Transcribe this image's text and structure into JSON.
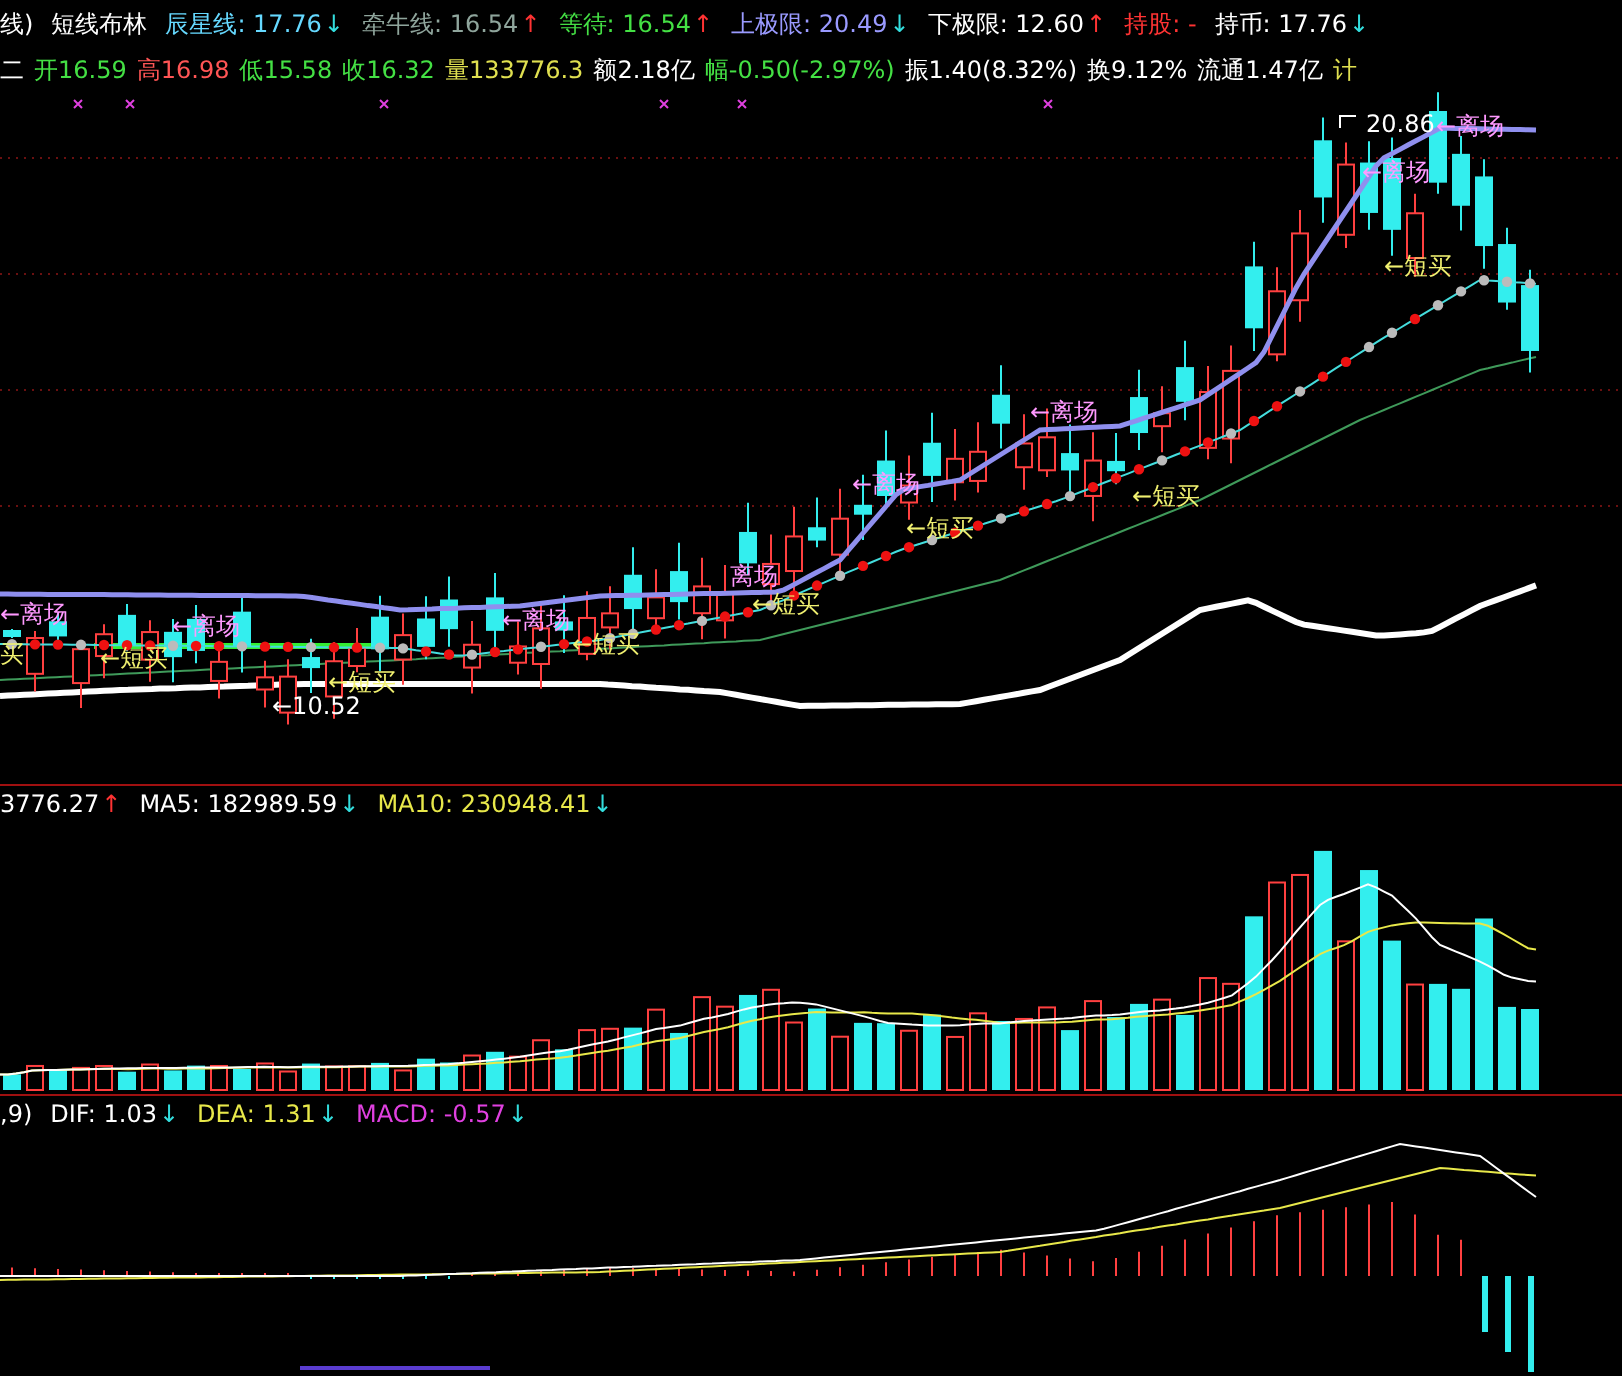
{
  "main_header": {
    "items": [
      {
        "text": "线)",
        "color": "#ffffff"
      },
      {
        "text": "短线布林",
        "color": "#ffffff"
      },
      {
        "text": "辰星线: 17.76",
        "color": "#66d9ff",
        "arrow": {
          "text": "↓",
          "color": "#33dddd"
        }
      },
      {
        "text": "牵牛线: 16.54",
        "color": "#8fa59c",
        "arrow": {
          "text": "↑",
          "color": "#ff3333"
        }
      },
      {
        "text": "等待: 16.54",
        "color": "#44e044",
        "arrow": {
          "text": "↑",
          "color": "#ff3333"
        }
      },
      {
        "text": "上极限: 20.49",
        "color": "#9a9aff",
        "arrow": {
          "text": "↓",
          "color": "#33dddd"
        }
      },
      {
        "text": "下极限: 12.60",
        "color": "#ffffff",
        "arrow": {
          "text": "↑",
          "color": "#ff3333"
        }
      },
      {
        "text": "持股: -",
        "color": "#ff3333"
      },
      {
        "text": "持币: 17.76",
        "color": "#ffffff",
        "arrow": {
          "text": "↓",
          "color": "#33dddd"
        }
      }
    ]
  },
  "quote_bar": {
    "items": [
      {
        "text": "二",
        "color": "#ffffff"
      },
      {
        "text": "开16.59",
        "color": "#44e044"
      },
      {
        "text": "高16.98",
        "color": "#ff5555"
      },
      {
        "text": "低15.58",
        "color": "#44e044"
      },
      {
        "text": "收16.32",
        "color": "#44e044"
      },
      {
        "text": "量133776.3",
        "color": "#e0e050"
      },
      {
        "text": "额2.18亿",
        "color": "#ffffff"
      },
      {
        "text": "幅-0.50(-2.97%)",
        "color": "#44e044"
      },
      {
        "text": "振1.40(8.32%)",
        "color": "#ffffff"
      },
      {
        "text": "换9.12%",
        "color": "#ffffff"
      },
      {
        "text": "流通1.47亿",
        "color": "#ffffff"
      },
      {
        "text": "计",
        "color": "#e0e050"
      }
    ]
  },
  "chart_labels": [
    {
      "kind": "exit",
      "text": "←离场"
    },
    {
      "kind": "buy",
      "text": "买"
    },
    {
      "kind": "buy",
      "text": "←短买"
    },
    {
      "kind": "exit",
      "text": "←离场"
    },
    {
      "kind": "price",
      "text": "←10.52"
    },
    {
      "kind": "buy",
      "text": "←短买"
    },
    {
      "kind": "exit",
      "text": "←离场"
    },
    {
      "kind": "buy",
      "text": "←短买"
    },
    {
      "kind": "exit",
      "text": "离场"
    },
    {
      "kind": "buy",
      "text": "←短买"
    },
    {
      "kind": "exit",
      "text": "←离场"
    },
    {
      "kind": "buy",
      "text": "←短买"
    },
    {
      "kind": "exit",
      "text": "←离场"
    },
    {
      "kind": "buy",
      "text": "←短买"
    },
    {
      "kind": "price",
      "text": "20.86"
    },
    {
      "kind": "exit",
      "text": "←离场"
    },
    {
      "kind": "exit",
      "text": "←离场"
    },
    {
      "kind": "buy",
      "text": "←短买"
    }
  ],
  "volume_header": {
    "items": [
      {
        "text": "3776.27",
        "color": "#ffffff",
        "arrow": {
          "text": "↑",
          "color": "#ff3333"
        }
      },
      {
        "text": "MA5: 182989.59",
        "color": "#ffffff",
        "arrow": {
          "text": "↓",
          "color": "#33dddd"
        }
      },
      {
        "text": "MA10: 230948.41",
        "color": "#e8e84a",
        "arrow": {
          "text": "↓",
          "color": "#33dddd"
        }
      }
    ]
  },
  "macd_header": {
    "items": [
      {
        "text": ",9)",
        "color": "#ffffff"
      },
      {
        "text": "DIF: 1.03",
        "color": "#ffffff",
        "arrow": {
          "text": "↓",
          "color": "#33dddd"
        }
      },
      {
        "text": "DEA: 1.31",
        "color": "#e8e84a",
        "arrow": {
          "text": "↓",
          "color": "#33dddd"
        }
      },
      {
        "text": "MACD: -0.57",
        "color": "#e040e0",
        "arrow": {
          "text": "↓",
          "color": "#33dddd"
        }
      }
    ]
  }
}
